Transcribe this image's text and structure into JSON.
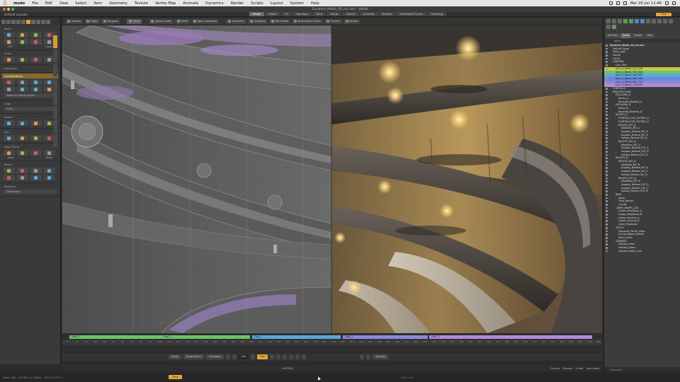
{
  "mac_menu": {
    "app": "modo",
    "items": [
      "File",
      "Edit",
      "View",
      "Select",
      "Item",
      "Geometry",
      "Texture",
      "Vertex Map",
      "Animate",
      "Dynamics",
      "Render",
      "Scripts",
      "Layout",
      "System",
      "Help"
    ],
    "clock": "Mar 26 jun 11:46"
  },
  "window": {
    "title": "Escalera_Modo_00_mc.lxo* - Modo"
  },
  "layout": {
    "selector": "Default Layouts",
    "tabs": [
      "Model",
      "Model",
      "UV",
      "Topology",
      "Paint",
      "Setup",
      "Games",
      "Animate",
      "Render",
      "Schematic Fusion",
      "Scripting"
    ],
    "active_tab_index": 0,
    "extra_button": "Only"
  },
  "viewport_toolbar": {
    "buttons": [
      "Vertices",
      "Edges",
      "Polygons",
      "Items",
      "Active Center",
      "Falloff",
      "Work Constraint",
      "Symmetry",
      "Snapping",
      "Work Plane",
      "Drop Action Center",
      "Preview",
      "Render"
    ]
  },
  "toolbox": {
    "sections": [
      {
        "title": "Basic",
        "rows": 2,
        "sub": [
          "Hall",
          "Loops"
        ]
      },
      {
        "title": "Draw",
        "rows": 1
      },
      {
        "title": "Hierarchy",
        "rows": 0
      },
      {
        "title": "Combinations",
        "rows": 2,
        "highlight": true,
        "wide": "Parent to Group Locator"
      },
      {
        "title": "Align",
        "rows": 0,
        "wide": "Unify"
      },
      {
        "title": "Match",
        "rows": 1
      },
      {
        "title": "Set",
        "rows": 1
      },
      {
        "title": "Work Plane",
        "rows": 1,
        "sub": [
          "Align",
          "Reset"
        ]
      },
      {
        "title": "Mirror",
        "rows": 2
      },
      {
        "title": "Measure",
        "rows": 0,
        "wide": "Dimensions"
      }
    ]
  },
  "timeline": {
    "cams": [
      {
        "label": "Cam_0",
        "color": "#6cc36c"
      },
      {
        "label": "Cam_1",
        "color": "#6cc36c"
      },
      {
        "label": "Cam_2",
        "color": "#5aa8d8"
      },
      {
        "label": "Cam_3",
        "color": "#8a8ad8"
      },
      {
        "label": "Cam_4",
        "color": "#b08ad8"
      }
    ],
    "ticks": [
      "0",
      "10",
      "20",
      "30",
      "40",
      "50",
      "60",
      "70",
      "80",
      "90",
      "100",
      "110",
      "120",
      "130",
      "140",
      "150",
      "160",
      "170",
      "180",
      "190",
      "200",
      "210",
      "220",
      "230",
      "240",
      "250",
      "260",
      "270",
      "280",
      "290",
      "300",
      "310",
      "320",
      "330",
      "340",
      "350",
      "360",
      "370",
      "380",
      "390",
      "400",
      "410",
      "420",
      "430",
      "440",
      "450",
      "460",
      "470",
      "480",
      "490",
      "500",
      "510",
      "520",
      "530",
      "540",
      "550",
      "560",
      "570",
      "580"
    ]
  },
  "transport": {
    "buttons": [
      "Audio",
      "Graph Editor",
      "Animated"
    ],
    "frame": "440",
    "play": "Play",
    "settings": "Settings"
  },
  "command_row": {
    "mapping": "MAPPING",
    "right": [
      "Backup",
      "Preview",
      "Guide",
      "Use model"
    ]
  },
  "status": {
    "info": "Tools: 464 - 23.745 | ◎ 195dm - 197.0, 8.077 ×",
    "time_button": "Time",
    "command_hint": "Cmd: cmd"
  },
  "right_panel": {
    "tabs": [
      "Add Item",
      "Items",
      "Shader",
      "Filter"
    ],
    "column_header": "Name",
    "tree": [
      {
        "name": "Escalera_Modo_00_mc.lxo*",
        "d": 0,
        "bold": true
      },
      {
        "name": "Texture Group",
        "d": 1
      },
      {
        "name": "Texto_Light",
        "d": 1
      },
      {
        "name": "FALLIN",
        "d": 1
      },
      {
        "name": "LUCES",
        "d": 1
      },
      {
        "name": "CAMERAS",
        "d": 1
      },
      {
        "name": "Cam_Test",
        "d": 2
      },
      {
        "name": "Cam_0_World_221_328",
        "d": 2,
        "bg": "#c9c940"
      },
      {
        "name": "Cam_1_World_328_438",
        "d": 2,
        "bg": "#6cc36c"
      },
      {
        "name": "Cam_2_World_438_583",
        "d": 2,
        "bg": "#5aa8d8"
      },
      {
        "name": "Cam_3_World_583_700",
        "d": 2,
        "bg": "#6c86d8"
      },
      {
        "name": "Cam_4_World_604_717",
        "d": 2,
        "bg": "#8a8ad8"
      },
      {
        "name": "Cam_5_World_718_833",
        "d": 2,
        "bg": "#b08ad8"
      },
      {
        "name": "CONTROLS",
        "d": 1
      },
      {
        "name": "ARQUITECTURA",
        "d": 1
      },
      {
        "name": "ESCALERA_A",
        "d": 2
      },
      {
        "name": "Rieles_A",
        "d": 3
      },
      {
        "name": "Baranda_Baranda_A",
        "d": 3
      },
      {
        "name": "ESCALERA_B",
        "d": 2
      },
      {
        "name": "Rieles_B",
        "d": 3
      },
      {
        "name": "Baranda_Baranda_B",
        "d": 3
      },
      {
        "name": "RELIEFS_A",
        "d": 2
      },
      {
        "name": "PORTION_FOR_TESTING_A",
        "d": 3
      },
      {
        "name": "PORTION_FOR_TESTING_B",
        "d": 3
      },
      {
        "name": "RELIEFS_INT_A",
        "d": 3
      },
      {
        "name": "Medallon_INT_A",
        "d": 4
      },
      {
        "name": "Angeles_Relieve_INT_A",
        "d": 4
      },
      {
        "name": "Angeles_Relieve_INT_B",
        "d": 4
      },
      {
        "name": "Volutas_Relieve_INT_A",
        "d": 4
      },
      {
        "name": "RELIEFS_EXT_A",
        "d": 3
      },
      {
        "name": "Medallon_EXT_A",
        "d": 4
      },
      {
        "name": "Angeles_Relieve_EXT_A",
        "d": 4
      },
      {
        "name": "Angeles_Relieve_EXT_B",
        "d": 4
      },
      {
        "name": "Volutas_Relieve_EXT_A",
        "d": 4
      },
      {
        "name": "RELIEFS_B",
        "d": 2
      },
      {
        "name": "RELIEFS_INT_B",
        "d": 3
      },
      {
        "name": "Medallon_INT_B",
        "d": 4
      },
      {
        "name": "Angeles_Relieve_INT_B",
        "d": 4
      },
      {
        "name": "Angeles_Relieve_INT_C",
        "d": 4
      },
      {
        "name": "Volutas_Relieve_INT_B",
        "d": 4
      },
      {
        "name": "RELIEFS_EXT_B",
        "d": 3
      },
      {
        "name": "Medallon_EXT_B",
        "d": 4
      },
      {
        "name": "Angeles_Relieve_EXT_B",
        "d": 4
      },
      {
        "name": "Angeles_Relieve_EXT_C",
        "d": 4
      },
      {
        "name": "Volutas_Relieve_EXT_B",
        "d": 4
      },
      {
        "name": "BASE",
        "d": 2
      },
      {
        "name": "Suelo",
        "d": 3
      },
      {
        "name": "Tubo_Alemar",
        "d": 3
      },
      {
        "name": "Cupula",
        "d": 3
      },
      {
        "name": "LAMPS_RAMPS_CEIL",
        "d": 2
      },
      {
        "name": "Lamps_Replicator_A",
        "d": 3
      },
      {
        "name": "Lamps_Replicator_B",
        "d": 3
      },
      {
        "name": "Lamps_Sources_A",
        "d": 3
      },
      {
        "name": "Lamps_Sources_B",
        "d": 3
      },
      {
        "name": "Lamp_Prototype",
        "d": 3
      },
      {
        "name": "TECHO",
        "d": 2
      },
      {
        "name": "Pequenos_Techo_Vidos",
        "d": 3
      },
      {
        "name": "Circulo_Negro_Adelas",
        "d": 3
      },
      {
        "name": "Techo_Vidro",
        "d": 3
      },
      {
        "name": "VIDRIERA",
        "d": 2
      },
      {
        "name": "Vidriera_Vidro",
        "d": 3
      },
      {
        "name": "Vidriera_Gatan",
        "d": 3
      },
      {
        "name": "Vidriera_Gatan_Inox",
        "d": 3
      }
    ],
    "bottom": "Command"
  }
}
